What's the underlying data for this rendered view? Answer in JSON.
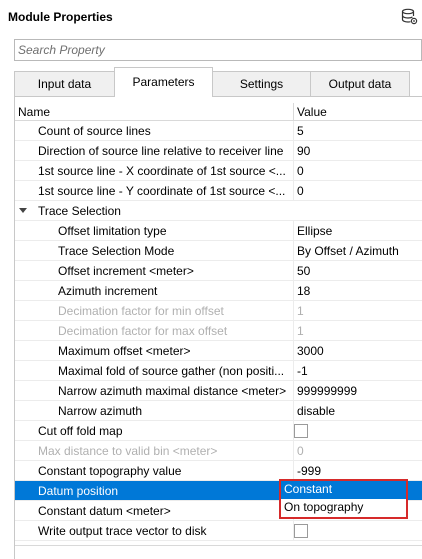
{
  "header": {
    "title": "Module Properties",
    "icon": "database-settings-icon"
  },
  "search": {
    "placeholder": "Search Property",
    "value": ""
  },
  "tabs": [
    {
      "label": "Input data",
      "active": false
    },
    {
      "label": "Parameters",
      "active": true
    },
    {
      "label": "Settings",
      "active": false
    },
    {
      "label": "Output data",
      "active": false
    }
  ],
  "grid": {
    "columns": {
      "name": "Name",
      "value": "Value"
    },
    "rows": [
      {
        "label": "Count of source lines",
        "value": "5"
      },
      {
        "label": "Direction of source line relative to receiver line",
        "value": "90"
      },
      {
        "label": "1st source line - X coordinate of 1st source <...",
        "value": "0"
      },
      {
        "label": "1st source line - Y coordinate of 1st source <...",
        "value": "0"
      },
      {
        "label": "Trace Selection",
        "group": true
      },
      {
        "label": "Offset limitation type",
        "value": "Ellipse"
      },
      {
        "label": "Trace Selection Mode",
        "value": "By Offset / Azimuth"
      },
      {
        "label": "Offset increment <meter>",
        "value": "50"
      },
      {
        "label": "Azimuth increment",
        "value": "18"
      },
      {
        "label": "Decimation factor for min offset",
        "value": "1",
        "disabled": true
      },
      {
        "label": "Decimation factor for max offset",
        "value": "1",
        "disabled": true
      },
      {
        "label": "Maximum offset <meter>",
        "value": "3000"
      },
      {
        "label": "Maximal fold of source gather (non positi...",
        "value": "-1"
      },
      {
        "label": "Narrow azimuth maximal distance <meter>",
        "value": "999999999"
      },
      {
        "label": "Narrow azimuth",
        "value": "disable"
      },
      {
        "label": "Cut off fold map",
        "checkbox": true
      },
      {
        "label": "Max distance to valid bin <meter>",
        "value": "0",
        "disabled": true
      },
      {
        "label": "Constant topography value",
        "value": "-999"
      },
      {
        "label": "Datum position",
        "value": "Constant",
        "selected": true
      },
      {
        "label": "Constant datum <meter>",
        "value": ""
      },
      {
        "label": "Write output trace vector to disk",
        "checkbox": true
      }
    ]
  },
  "dropdown": {
    "options": [
      "Constant",
      "On topography"
    ],
    "selected": "Constant"
  }
}
